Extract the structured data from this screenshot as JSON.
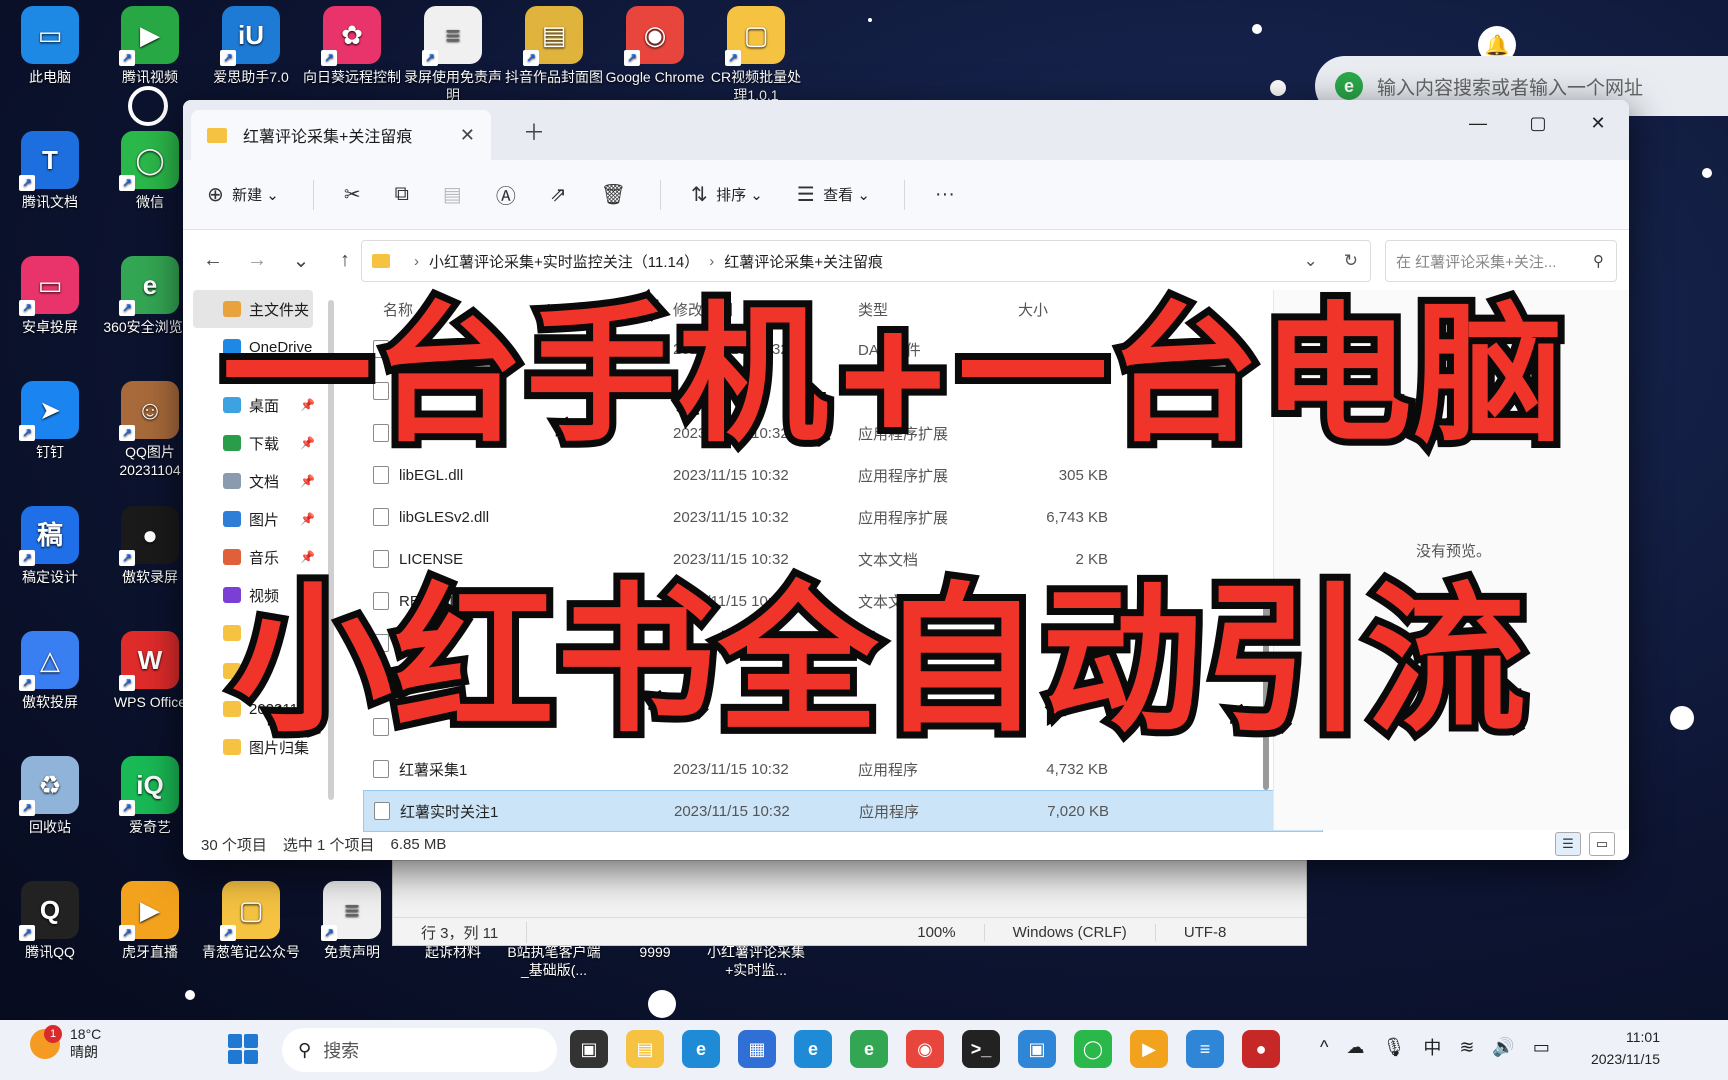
{
  "desktop": {
    "icons": [
      {
        "label": "此电脑",
        "color": "#1e88e5",
        "glyph": "▭"
      },
      {
        "label": "腾讯视频",
        "color": "#27a844",
        "glyph": "▶"
      },
      {
        "label": "爱思助手7.0",
        "color": "#1d7bd6",
        "glyph": "iU"
      },
      {
        "label": "向日葵远程控制",
        "color": "#e8346a",
        "glyph": "✿"
      },
      {
        "label": "录屏使用免责声明",
        "color": "#f0f0f0",
        "glyph": "≡"
      },
      {
        "label": "抖音作品封面图",
        "color": "#e0b33c",
        "glyph": "▤"
      },
      {
        "label": "Google Chrome",
        "color": "#e8453c",
        "glyph": "◉"
      },
      {
        "label": "CR视频批量处理1.0.1",
        "color": "#f5c242",
        "glyph": "▢"
      },
      {
        "label": "腾讯文档",
        "color": "#1d6fe0",
        "glyph": "T"
      },
      {
        "label": "微信",
        "color": "#2bb84a",
        "glyph": "◯"
      },
      {
        "label": "安卓投屏",
        "color": "#e8346a",
        "glyph": "▭"
      },
      {
        "label": "360安全浏览器",
        "color": "#33a653",
        "glyph": "e"
      },
      {
        "label": "钉钉",
        "color": "#1a84f0",
        "glyph": "➤"
      },
      {
        "label": "QQ图片20231104",
        "color": "#a86a3a",
        "glyph": "☺"
      },
      {
        "label": "稿定设计",
        "color": "#1e6fe8",
        "glyph": "稿"
      },
      {
        "label": "傲软录屏",
        "color": "#1a1a1a",
        "glyph": "●"
      },
      {
        "label": "傲软投屏",
        "color": "#3a7ff2",
        "glyph": "△"
      },
      {
        "label": "WPS Office",
        "color": "#e02b2b",
        "glyph": "W"
      },
      {
        "label": "回收站",
        "color": "#8fb3d9",
        "glyph": "♻"
      },
      {
        "label": "爱奇艺",
        "color": "#19b955",
        "glyph": "iQ"
      },
      {
        "label": "腾讯QQ",
        "color": "#222222",
        "glyph": "Q"
      },
      {
        "label": "虎牙直播",
        "color": "#f2a21d",
        "glyph": "▶"
      },
      {
        "label": "青葱笔记公众号",
        "color": "#f5c242",
        "glyph": "▢"
      },
      {
        "label": "免责声明",
        "color": "#f0f0f0",
        "glyph": "≡"
      },
      {
        "label": "起诉材料",
        "color": "#f5c242",
        "glyph": "▢"
      },
      {
        "label": "B站执笔客户端_基础版(...",
        "color": "#f5c242",
        "glyph": "▢"
      },
      {
        "label": "9999",
        "color": "#f5c242",
        "glyph": "▢"
      },
      {
        "label": "小红薯评论采集+实时监...",
        "color": "#f5c242",
        "glyph": "▢"
      }
    ]
  },
  "edge": {
    "placeholder": "输入内容搜索或者输入一个网址"
  },
  "notepad": {
    "position": "行 3，列 11",
    "zoom": "100%",
    "eol": "Windows (CRLF)",
    "encoding": "UTF-8"
  },
  "explorer": {
    "tab_title": "红薯评论采集+关注留痕",
    "toolbar": {
      "new": "新建",
      "sort": "排序",
      "view": "查看",
      "more": "···"
    },
    "breadcrumb": [
      "小红薯评论采集+实时监控关注（11.14）",
      "红薯评论采集+关注留痕"
    ],
    "search_placeholder": "在 红薯评论采集+关注...",
    "nav": [
      {
        "label": "主文件夹",
        "color": "#e8a33c"
      },
      {
        "label": "OneDrive",
        "color": "#1e88e5"
      },
      {
        "label": "桌面",
        "color": "#3ba3e0"
      },
      {
        "label": "下载",
        "color": "#2a9d4a"
      },
      {
        "label": "文档",
        "color": "#8a9bb0"
      },
      {
        "label": "图片",
        "color": "#2e7dd6"
      },
      {
        "label": "音乐",
        "color": "#e0603a"
      },
      {
        "label": "视频",
        "color": "#7b3fd6"
      },
      {
        "label": "",
        "color": "#f5c242"
      },
      {
        "label": "",
        "color": "#f5c242"
      },
      {
        "label": "2023111",
        "color": "#f5c242"
      },
      {
        "label": "图片归集",
        "color": "#f5c242"
      }
    ],
    "columns": {
      "name": "名称",
      "date": "修改日期",
      "type": "类型",
      "size": "大小"
    },
    "files": [
      {
        "name": "",
        "date": "2023/11/15 10:32",
        "type": "DAT 文件",
        "size": ""
      },
      {
        "name": "",
        "date": "",
        "type": "",
        "size": ""
      },
      {
        "name": "",
        "date": "2023/11/15 10:32",
        "type": "应用程序扩展",
        "size": ""
      },
      {
        "name": "libEGL.dll",
        "date": "2023/11/15 10:32",
        "type": "应用程序扩展",
        "size": "305 KB"
      },
      {
        "name": "libGLESv2.dll",
        "date": "2023/11/15 10:32",
        "type": "应用程序扩展",
        "size": "6,743 KB"
      },
      {
        "name": "LICENSE",
        "date": "2023/11/15 10:32",
        "type": "文本文档",
        "size": "2 KB"
      },
      {
        "name": "README",
        "date": "2023/11/15 10:32",
        "type": "文本文档",
        "size": "5 KB"
      },
      {
        "name": "",
        "date": "",
        "type": "",
        "size": ""
      },
      {
        "name": "",
        "date": "",
        "type": "",
        "size": ""
      },
      {
        "name": "",
        "date": "",
        "type": "",
        "size": ""
      },
      {
        "name": "红薯采集1",
        "date": "2023/11/15 10:32",
        "type": "应用程序",
        "size": "4,732 KB"
      },
      {
        "name": "红薯实时关注1",
        "date": "2023/11/15 10:32",
        "type": "应用程序",
        "size": "7,020 KB"
      }
    ],
    "preview_msg": "没有预览。",
    "status": {
      "count": "30 个项目",
      "selected": "选中 1 个项目",
      "size": "6.85 MB"
    }
  },
  "captions": {
    "line1": "一台手机+一台电脑",
    "line2": "小红书全自动引流"
  },
  "taskbar": {
    "weather_temp": "18°C",
    "weather_desc": "晴朗",
    "weather_badge": "1",
    "search_placeholder": "搜索",
    "apps": [
      {
        "name": "task-view-app",
        "color": "#333333",
        "glyph": "▣"
      },
      {
        "name": "file-explorer-app",
        "color": "#f5c242",
        "glyph": "▤"
      },
      {
        "name": "edge-app",
        "color": "#1f8ad6",
        "glyph": "e"
      },
      {
        "name": "store-app",
        "color": "#2f6fd6",
        "glyph": "▦"
      },
      {
        "name": "ie-app",
        "color": "#1f8ad6",
        "glyph": "e"
      },
      {
        "name": "360-browser-app",
        "color": "#33a653",
        "glyph": "e"
      },
      {
        "name": "chrome-app",
        "color": "#e8453c",
        "glyph": "◉"
      },
      {
        "name": "terminal-app",
        "color": "#222222",
        "glyph": ">_"
      },
      {
        "name": "image-tool-app",
        "color": "#2f86d6",
        "glyph": "▣"
      },
      {
        "name": "wechat-app",
        "color": "#2bb84a",
        "glyph": "◯"
      },
      {
        "name": "huya-app",
        "color": "#f2a21d",
        "glyph": "▶"
      },
      {
        "name": "notepad-app",
        "color": "#2f86d6",
        "glyph": "≡"
      },
      {
        "name": "recorder-app",
        "color": "#c62828",
        "glyph": "●"
      }
    ],
    "ime": "中",
    "time": "11:01",
    "date": "2023/11/15"
  }
}
